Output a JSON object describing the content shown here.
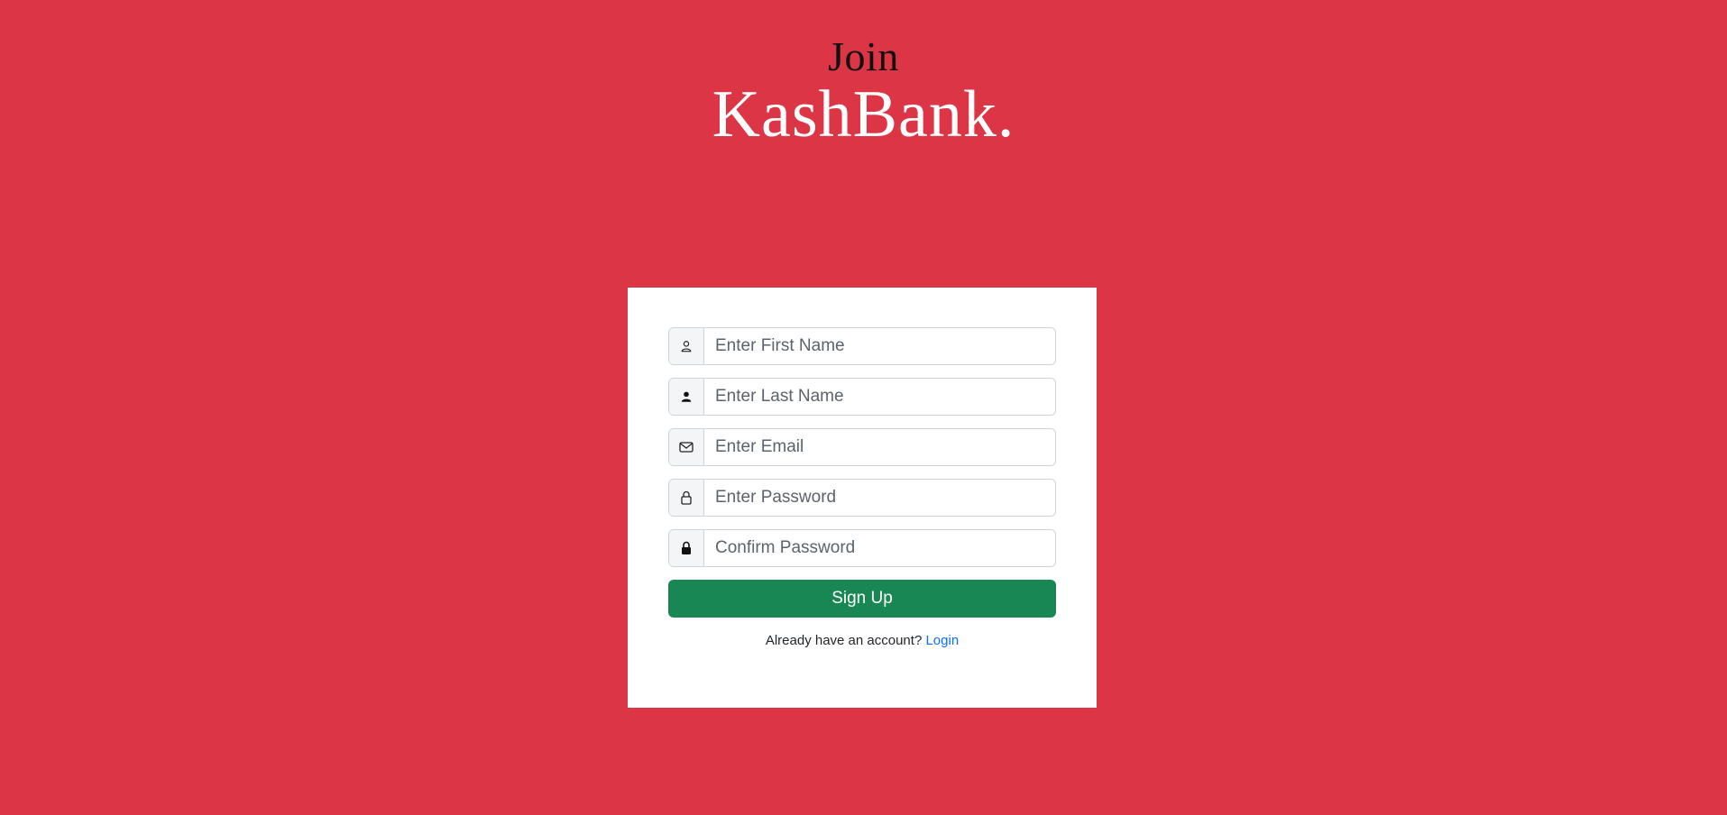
{
  "header": {
    "join_text": "Join",
    "brand_name": "KashBank."
  },
  "form": {
    "fields": [
      {
        "icon": "person-outline-icon",
        "placeholder": "Enter First Name",
        "value": ""
      },
      {
        "icon": "person-filled-icon",
        "placeholder": "Enter Last Name",
        "value": ""
      },
      {
        "icon": "envelope-icon",
        "placeholder": "Enter Email",
        "value": ""
      },
      {
        "icon": "lock-outline-icon",
        "placeholder": "Enter Password",
        "value": ""
      },
      {
        "icon": "lock-filled-icon",
        "placeholder": "Confirm Password",
        "value": ""
      }
    ],
    "submit_label": "Sign Up",
    "login_prompt": "Already have an account?",
    "login_link": "Login"
  },
  "colors": {
    "background": "#dc3545",
    "card": "#ffffff",
    "submit_button": "#198754",
    "link": "#0d6efd"
  }
}
